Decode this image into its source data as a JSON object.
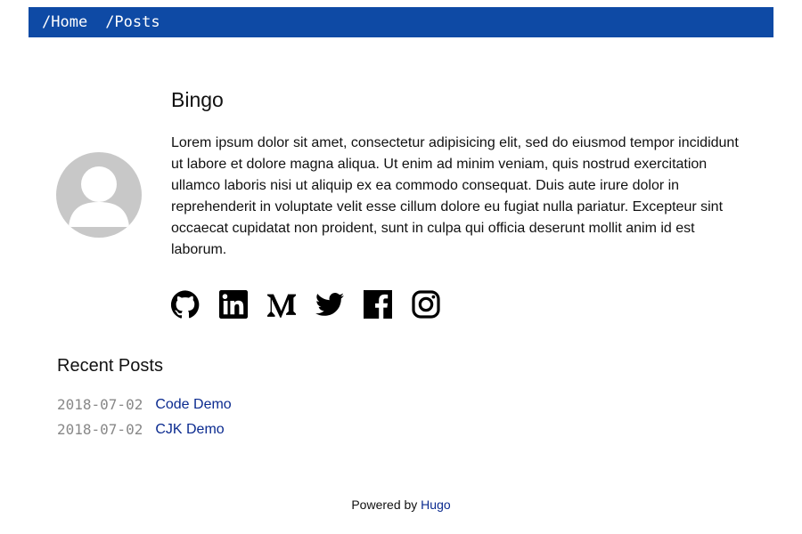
{
  "nav": {
    "items": [
      {
        "label": "/Home"
      },
      {
        "label": "/Posts"
      }
    ]
  },
  "profile": {
    "avatar_icon": "default-avatar-icon",
    "name": "Bingo",
    "bio": "Lorem ipsum dolor sit amet, consectetur adipisicing elit, sed do eiusmod tempor incididunt ut labore et dolore magna aliqua. Ut enim ad minim veniam, quis nostrud exercitation ullamco laboris nisi ut aliquip ex ea commodo consequat. Duis aute irure dolor in reprehenderit in voluptate velit esse cillum dolore eu fugiat nulla pariatur. Excepteur sint occaecat cupidatat non proident, sunt in culpa qui officia deserunt mollit anim id est laborum."
  },
  "social": {
    "icons": [
      "github-icon",
      "linkedin-icon",
      "medium-icon",
      "twitter-icon",
      "facebook-icon",
      "instagram-icon"
    ]
  },
  "recent_posts": {
    "title": "Recent Posts",
    "items": [
      {
        "date": "2018-07-02",
        "title": "Code Demo"
      },
      {
        "date": "2018-07-02",
        "title": "CJK Demo"
      }
    ]
  },
  "footer": {
    "prefix": "Powered by",
    "link": "Hugo"
  },
  "colors": {
    "nav_background": "#0e4aa5",
    "link": "#0a2a8f",
    "date": "#888888",
    "avatar": "#c8c8c8"
  }
}
